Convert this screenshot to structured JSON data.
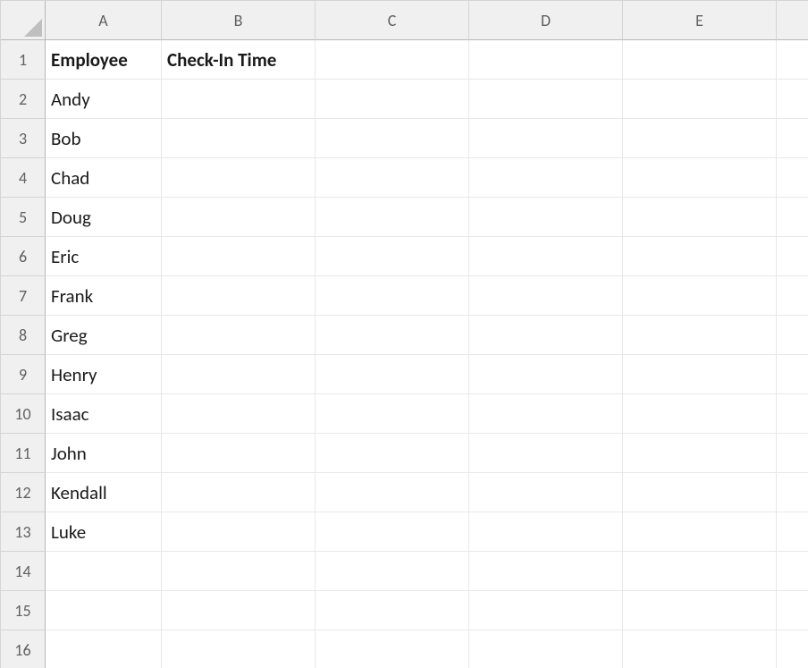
{
  "columns": [
    "A",
    "B",
    "C",
    "D",
    "E"
  ],
  "rows": [
    "1",
    "2",
    "3",
    "4",
    "5",
    "6",
    "7",
    "8",
    "9",
    "10",
    "11",
    "12",
    "13",
    "14",
    "15",
    "16"
  ],
  "headers": {
    "A": "Employee",
    "B": "Check-In Time"
  },
  "employees": [
    {
      "name": "Andy",
      "check_in": ""
    },
    {
      "name": "Bob",
      "check_in": ""
    },
    {
      "name": "Chad",
      "check_in": ""
    },
    {
      "name": "Doug",
      "check_in": ""
    },
    {
      "name": "Eric",
      "check_in": ""
    },
    {
      "name": "Frank",
      "check_in": ""
    },
    {
      "name": "Greg",
      "check_in": ""
    },
    {
      "name": "Henry",
      "check_in": ""
    },
    {
      "name": "Isaac",
      "check_in": ""
    },
    {
      "name": "John",
      "check_in": ""
    },
    {
      "name": "Kendall",
      "check_in": ""
    },
    {
      "name": "Luke",
      "check_in": ""
    }
  ]
}
